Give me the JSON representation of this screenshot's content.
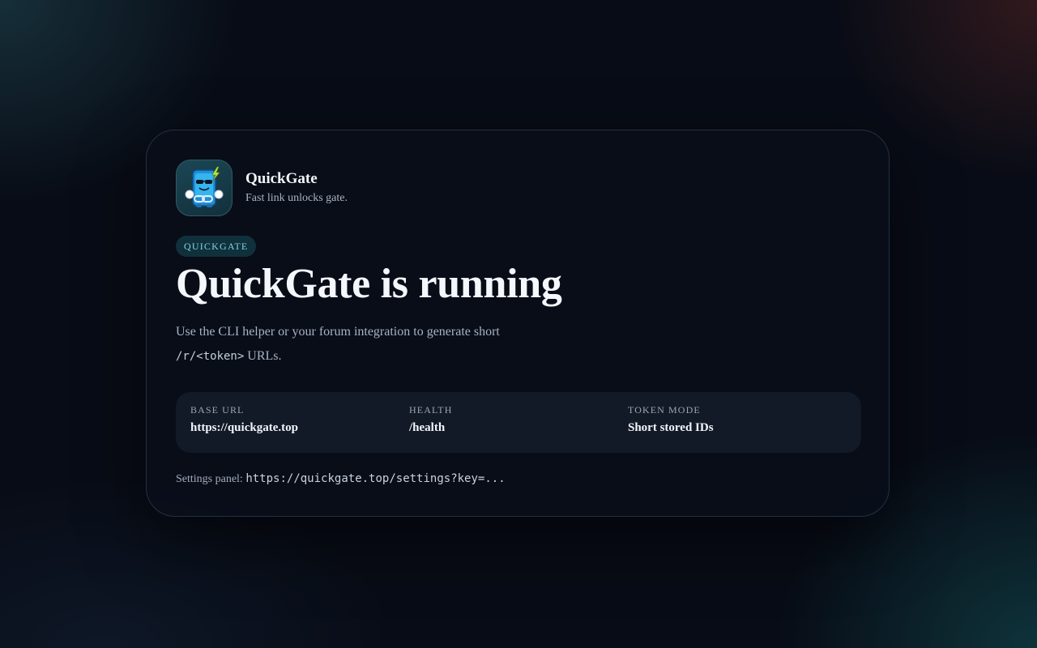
{
  "app": {
    "name": "QuickGate",
    "tagline": "Fast link unlocks gate.",
    "icon": "robot-mascot-logo-icon"
  },
  "badge": {
    "label": "QUICKGATE"
  },
  "headline": "QuickGate is running",
  "description": {
    "text_before": "Use the CLI helper or your forum integration to generate short",
    "code": "/r/<token>",
    "text_after": " URLs."
  },
  "info": [
    {
      "label": "BASE URL",
      "value": "https://quickgate.top"
    },
    {
      "label": "HEALTH",
      "value": "/health"
    },
    {
      "label": "TOKEN MODE",
      "value": "Short stored IDs"
    }
  ],
  "settings": {
    "label": "Settings panel: ",
    "url": "https://quickgate.top/settings?key=..."
  },
  "colors": {
    "background": "#080c16",
    "card": "#090e19",
    "badge_text": "#7fd4e4",
    "panel": "#121a27"
  }
}
